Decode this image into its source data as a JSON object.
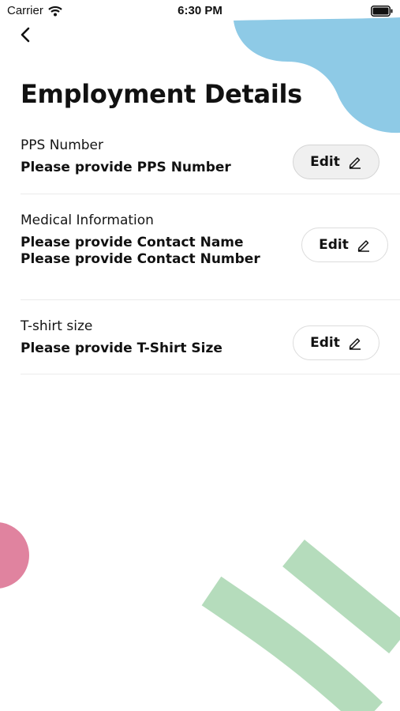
{
  "status_bar": {
    "carrier": "Carrier",
    "time": "6:30 PM",
    "wifi_icon": "wifi-icon",
    "battery_icon": "battery-icon"
  },
  "nav": {
    "back_icon": "chevron-left-icon"
  },
  "title": "Employment Details",
  "sections": [
    {
      "label": "PPS Number",
      "values": [
        "Please provide PPS Number"
      ],
      "edit_label": "Edit",
      "edit_icon": "pencil-icon",
      "pressed": true
    },
    {
      "label": "Medical Information",
      "values": [
        "Please provide Contact Name",
        "Please provide Contact Number"
      ],
      "edit_label": "Edit",
      "edit_icon": "pencil-icon",
      "pressed": false
    },
    {
      "label": "T-shirt size",
      "values": [
        "Please provide T-Shirt Size"
      ],
      "edit_label": "Edit",
      "edit_icon": "pencil-icon",
      "pressed": false
    }
  ],
  "colors": {
    "blue_blob": "#8ecae6",
    "pink_blob": "#e0839f",
    "green_stroke": "#b5dcbc"
  }
}
